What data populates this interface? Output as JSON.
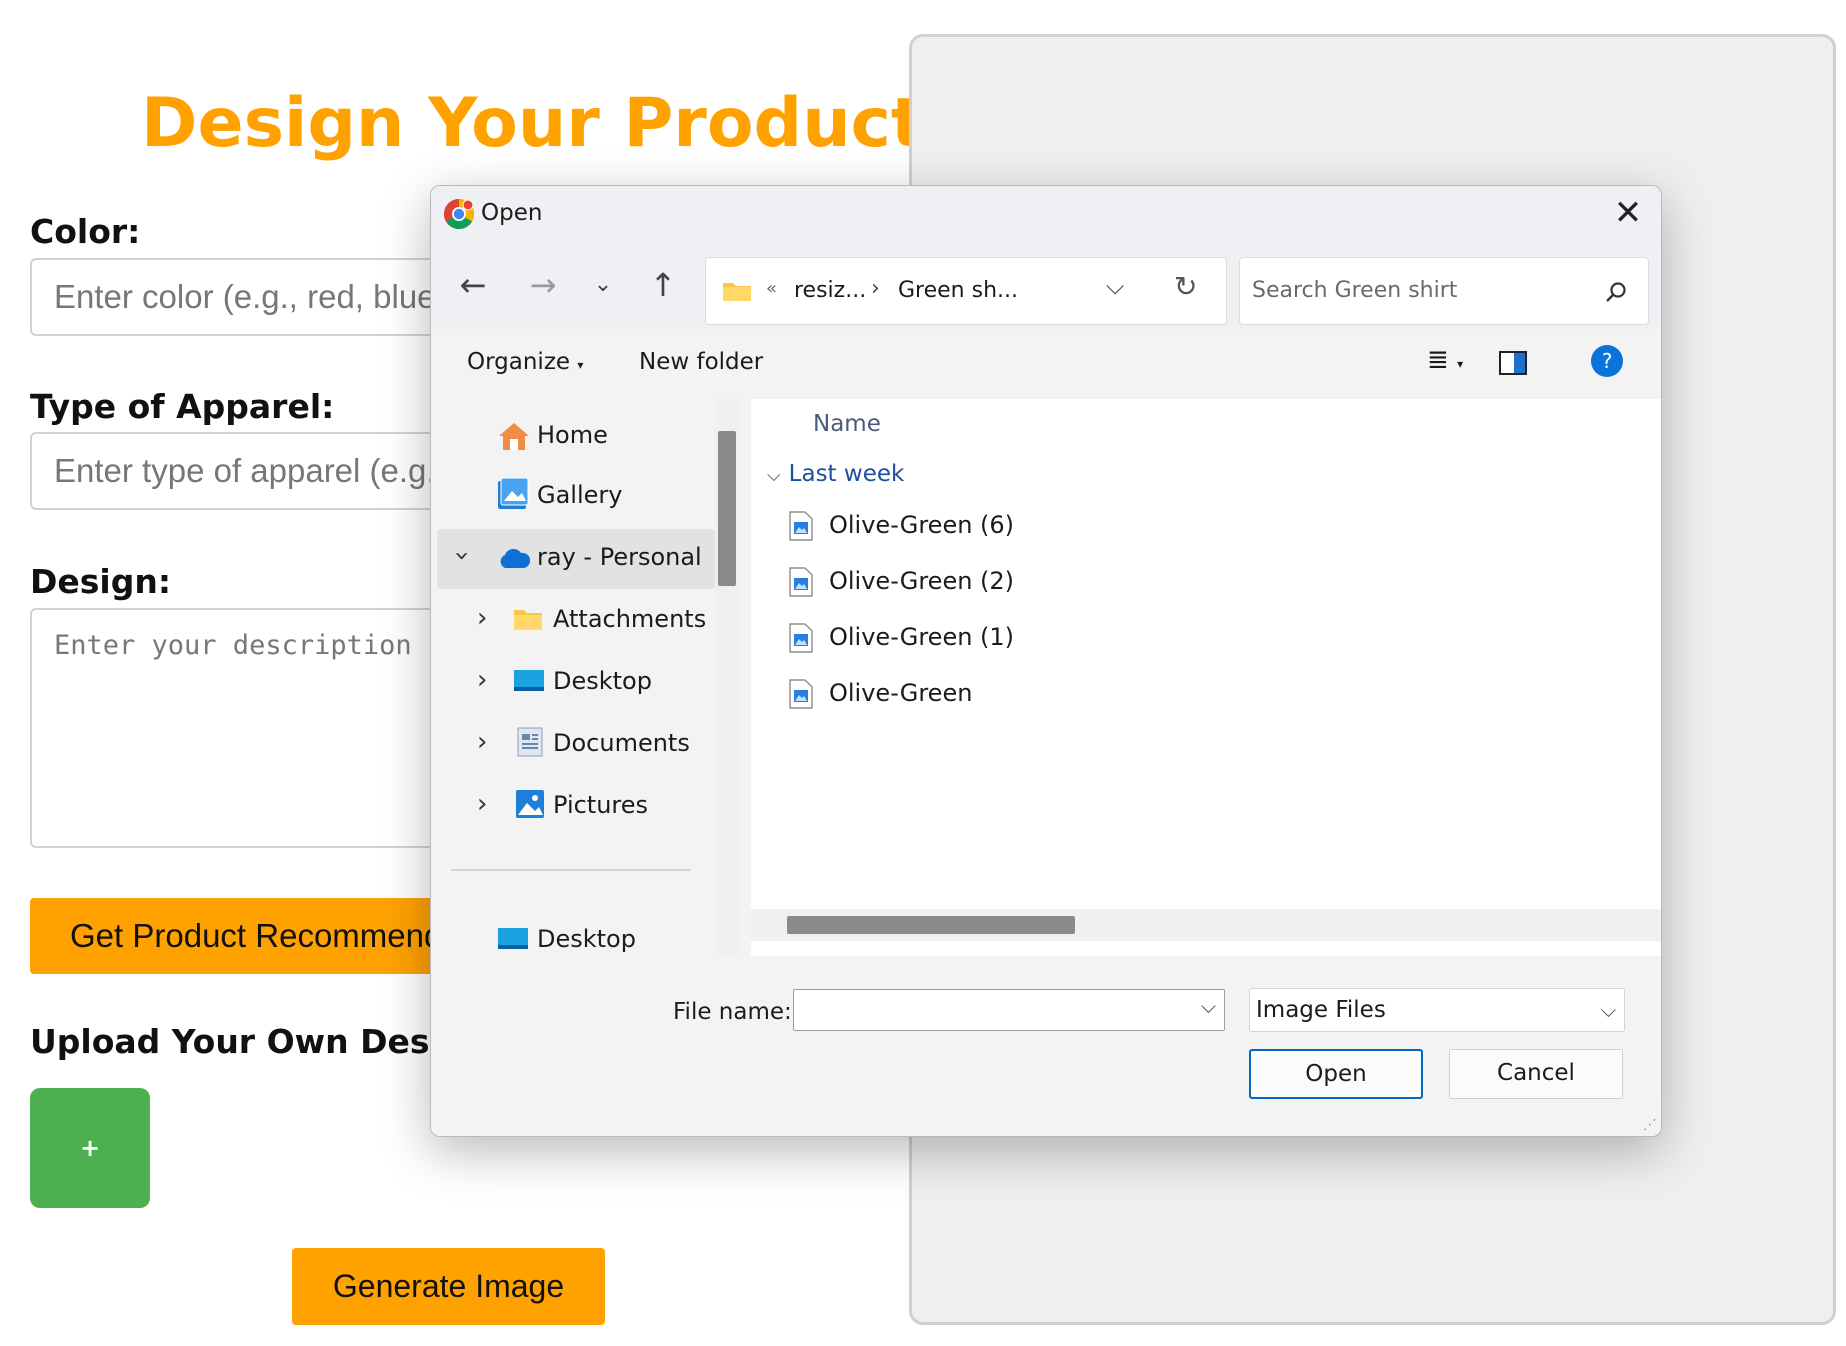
{
  "page": {
    "title": "Design Your Product",
    "color_label": "Color:",
    "color_placeholder": "Enter color (e.g., red, blue,",
    "apparel_label": "Type of Apparel:",
    "apparel_placeholder": "Enter type of apparel (e.g.,",
    "design_label": "Design:",
    "design_placeholder": "Enter your description (e",
    "recommend_button": "Get Product Recommend",
    "upload_label": "Upload Your Own Design (",
    "upload_button": "+",
    "generate_button": "Generate Image"
  },
  "dialog": {
    "title": "Open",
    "address": {
      "overflow": "«",
      "crumbs": [
        "resiz...",
        "Green sh..."
      ]
    },
    "search_placeholder": "Search Green shirt",
    "commands": {
      "organize": "Organize",
      "new_folder": "New folder"
    },
    "sidebar": {
      "items": [
        {
          "label": "Home",
          "icon": "home-icon"
        },
        {
          "label": "Gallery",
          "icon": "gallery-icon"
        },
        {
          "label": "ray - Personal",
          "icon": "onedrive-icon",
          "selected": true
        },
        {
          "label": "Attachments",
          "icon": "folder-icon"
        },
        {
          "label": "Desktop",
          "icon": "desktop-icon"
        },
        {
          "label": "Documents",
          "icon": "documents-icon"
        },
        {
          "label": "Pictures",
          "icon": "pictures-icon"
        },
        {
          "label": "Desktop",
          "icon": "desktop-icon"
        }
      ]
    },
    "columns": {
      "name": "Name"
    },
    "group": "Last week",
    "files": [
      "Olive-Green (6)",
      "Olive-Green (2)",
      "Olive-Green (1)",
      "Olive-Green"
    ],
    "file_name_label": "File name:",
    "file_name_value": "",
    "file_type": "Image Files",
    "open_button": "Open",
    "cancel_button": "Cancel"
  },
  "colors": {
    "accent_orange": "#ffa200",
    "upload_green": "#4caf50",
    "dialog_primary_border": "#0067c0",
    "help_blue": "#0a74da"
  }
}
